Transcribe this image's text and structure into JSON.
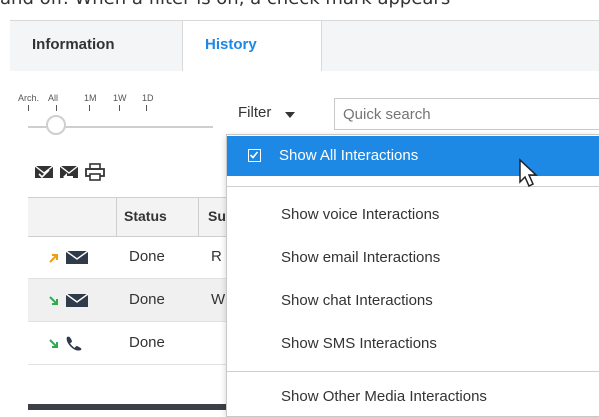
{
  "caption": "and off. When a filter is on, a check mark appears",
  "tabs": [
    {
      "label": "Information",
      "active": false
    },
    {
      "label": "History",
      "active": true
    }
  ],
  "timeline": {
    "labels": [
      "Arch.",
      "All",
      "1M",
      "1W",
      "1D"
    ]
  },
  "filter": {
    "label": "Filter"
  },
  "search": {
    "placeholder": "Quick search"
  },
  "toolbar": {
    "icons": [
      "mark-done-icon",
      "reply-icon",
      "print-icon"
    ]
  },
  "grid": {
    "headers": [
      "Status",
      "Su"
    ],
    "rows": [
      {
        "direction": "outbound",
        "media": "email",
        "status": "Done",
        "subject": "R"
      },
      {
        "direction": "inbound",
        "media": "email",
        "status": "Done",
        "subject": "W"
      },
      {
        "direction": "inbound",
        "media": "voice",
        "status": "Done",
        "subject": ""
      }
    ]
  },
  "menu": {
    "items": [
      {
        "label": "Show All Interactions",
        "checked": true,
        "selected": true
      },
      {
        "label": "Show voice Interactions",
        "checked": false
      },
      {
        "label": "Show email Interactions",
        "checked": false
      },
      {
        "label": "Show chat Interactions",
        "checked": false
      },
      {
        "label": "Show SMS Interactions",
        "checked": false
      },
      {
        "label": "Show Other Media Interactions",
        "checked": false
      }
    ]
  },
  "colors": {
    "accent": "#1e88e5",
    "outbound_arrow": "#f39c12",
    "inbound_arrow": "#2eab4f"
  }
}
